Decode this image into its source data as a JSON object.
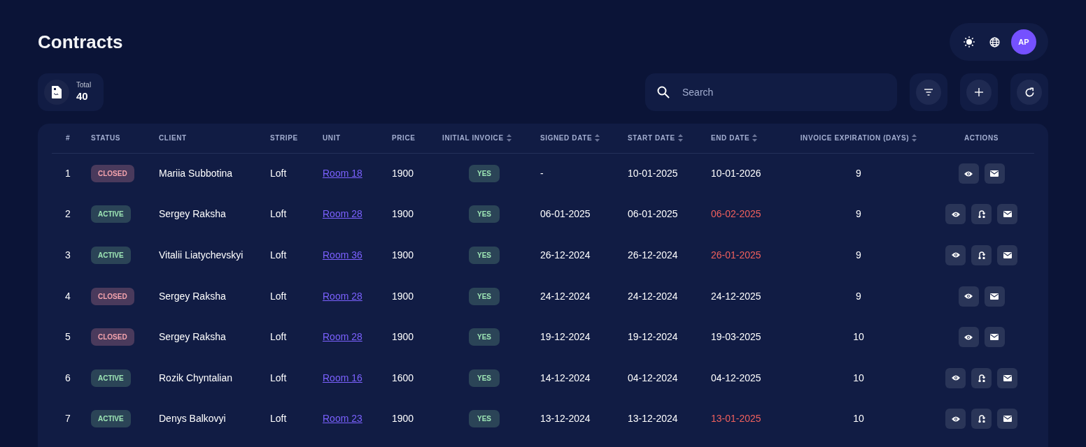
{
  "page": {
    "title": "Contracts"
  },
  "header_controls": {
    "avatar_initials": "AP"
  },
  "summary": {
    "label": "Total",
    "value": "40"
  },
  "search": {
    "placeholder": "Search"
  },
  "table": {
    "columns": [
      {
        "label": "#",
        "sortable": false
      },
      {
        "label": "STATUS",
        "sortable": false
      },
      {
        "label": "CLIENT",
        "sortable": false
      },
      {
        "label": "STRIPE",
        "sortable": false
      },
      {
        "label": "UNIT",
        "sortable": false
      },
      {
        "label": "PRICE",
        "sortable": false
      },
      {
        "label": "INITIAL INVOICE",
        "sortable": true
      },
      {
        "label": "SIGNED DATE",
        "sortable": true
      },
      {
        "label": "START DATE",
        "sortable": true
      },
      {
        "label": "END DATE",
        "sortable": true
      },
      {
        "label": "INVOICE EXPIRATION (DAYS)",
        "sortable": true
      },
      {
        "label": "ACTIONS",
        "sortable": false
      }
    ],
    "rows": [
      {
        "number": "1",
        "status": {
          "label": "CLOSED",
          "kind": "closed"
        },
        "client": "Mariia Subbotina",
        "stripe": "Loft",
        "unit": "Room 18",
        "price": "1900",
        "initial_invoice": "YES",
        "signed_date": "-",
        "start_date": "10-01-2025",
        "end_date": "10-01-2026",
        "end_overdue": false,
        "invoice_expiration": "9",
        "actions": [
          {
            "kind": "view"
          },
          {
            "kind": "email"
          }
        ]
      },
      {
        "number": "2",
        "status": {
          "label": "ACTIVE",
          "kind": "active"
        },
        "client": "Sergey Raksha",
        "stripe": "Loft",
        "unit": "Room 28",
        "price": "1900",
        "initial_invoice": "YES",
        "signed_date": "06-01-2025",
        "start_date": "06-01-2025",
        "end_date": "06-02-2025",
        "end_overdue": true,
        "invoice_expiration": "9",
        "actions": [
          {
            "kind": "view"
          },
          {
            "kind": "transfer"
          },
          {
            "kind": "email"
          }
        ]
      },
      {
        "number": "3",
        "status": {
          "label": "ACTIVE",
          "kind": "active"
        },
        "client": "Vitalii Liatychevskyi",
        "stripe": "Loft",
        "unit": "Room 36",
        "price": "1900",
        "initial_invoice": "YES",
        "signed_date": "26-12-2024",
        "start_date": "26-12-2024",
        "end_date": "26-01-2025",
        "end_overdue": true,
        "invoice_expiration": "9",
        "actions": [
          {
            "kind": "view"
          },
          {
            "kind": "transfer"
          },
          {
            "kind": "email"
          }
        ]
      },
      {
        "number": "4",
        "status": {
          "label": "CLOSED",
          "kind": "closed"
        },
        "client": "Sergey Raksha",
        "stripe": "Loft",
        "unit": "Room 28",
        "price": "1900",
        "initial_invoice": "YES",
        "signed_date": "24-12-2024",
        "start_date": "24-12-2024",
        "end_date": "24-12-2025",
        "end_overdue": false,
        "invoice_expiration": "9",
        "actions": [
          {
            "kind": "view"
          },
          {
            "kind": "email"
          }
        ]
      },
      {
        "number": "5",
        "status": {
          "label": "CLOSED",
          "kind": "closed"
        },
        "client": "Sergey Raksha",
        "stripe": "Loft",
        "unit": "Room 28",
        "price": "1900",
        "initial_invoice": "YES",
        "signed_date": "19-12-2024",
        "start_date": "19-12-2024",
        "end_date": "19-03-2025",
        "end_overdue": false,
        "invoice_expiration": "10",
        "actions": [
          {
            "kind": "view"
          },
          {
            "kind": "email"
          }
        ]
      },
      {
        "number": "6",
        "status": {
          "label": "ACTIVE",
          "kind": "active"
        },
        "client": "Rozik Chyntalian",
        "stripe": "Loft",
        "unit": "Room 16",
        "price": "1600",
        "initial_invoice": "YES",
        "signed_date": "14-12-2024",
        "start_date": "04-12-2024",
        "end_date": "04-12-2025",
        "end_overdue": false,
        "invoice_expiration": "10",
        "actions": [
          {
            "kind": "view"
          },
          {
            "kind": "transfer"
          },
          {
            "kind": "email"
          }
        ]
      },
      {
        "number": "7",
        "status": {
          "label": "ACTIVE",
          "kind": "active"
        },
        "client": "Denys Balkovyi",
        "stripe": "Loft",
        "unit": "Room 23",
        "price": "1900",
        "initial_invoice": "YES",
        "signed_date": "13-12-2024",
        "start_date": "13-12-2024",
        "end_date": "13-01-2025",
        "end_overdue": true,
        "invoice_expiration": "10",
        "actions": [
          {
            "kind": "view"
          },
          {
            "kind": "transfer"
          },
          {
            "kind": "email"
          }
        ]
      }
    ]
  }
}
